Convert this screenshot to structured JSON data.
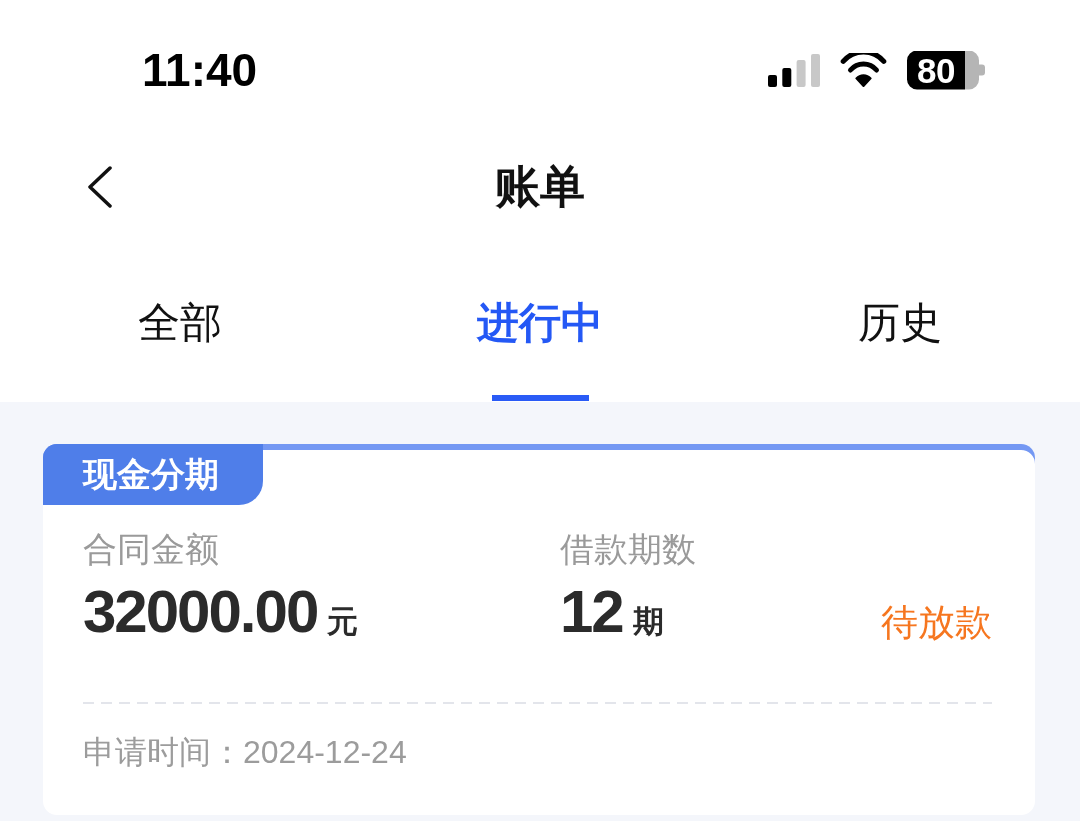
{
  "status_bar": {
    "time": "11:40",
    "battery": "80"
  },
  "nav": {
    "title": "账单"
  },
  "tabs": [
    {
      "label": "全部",
      "selected": false
    },
    {
      "label": "进行中",
      "selected": true
    },
    {
      "label": "历史",
      "selected": false
    }
  ],
  "bills": [
    {
      "tag": "现金分期",
      "amount_label": "合同金额",
      "amount": "32000.00",
      "amount_unit": "元",
      "term_label": "借款期数",
      "term": "12",
      "term_unit": "期",
      "status": "待放款",
      "apply_time": "申请时间：2024-12-24"
    }
  ]
}
